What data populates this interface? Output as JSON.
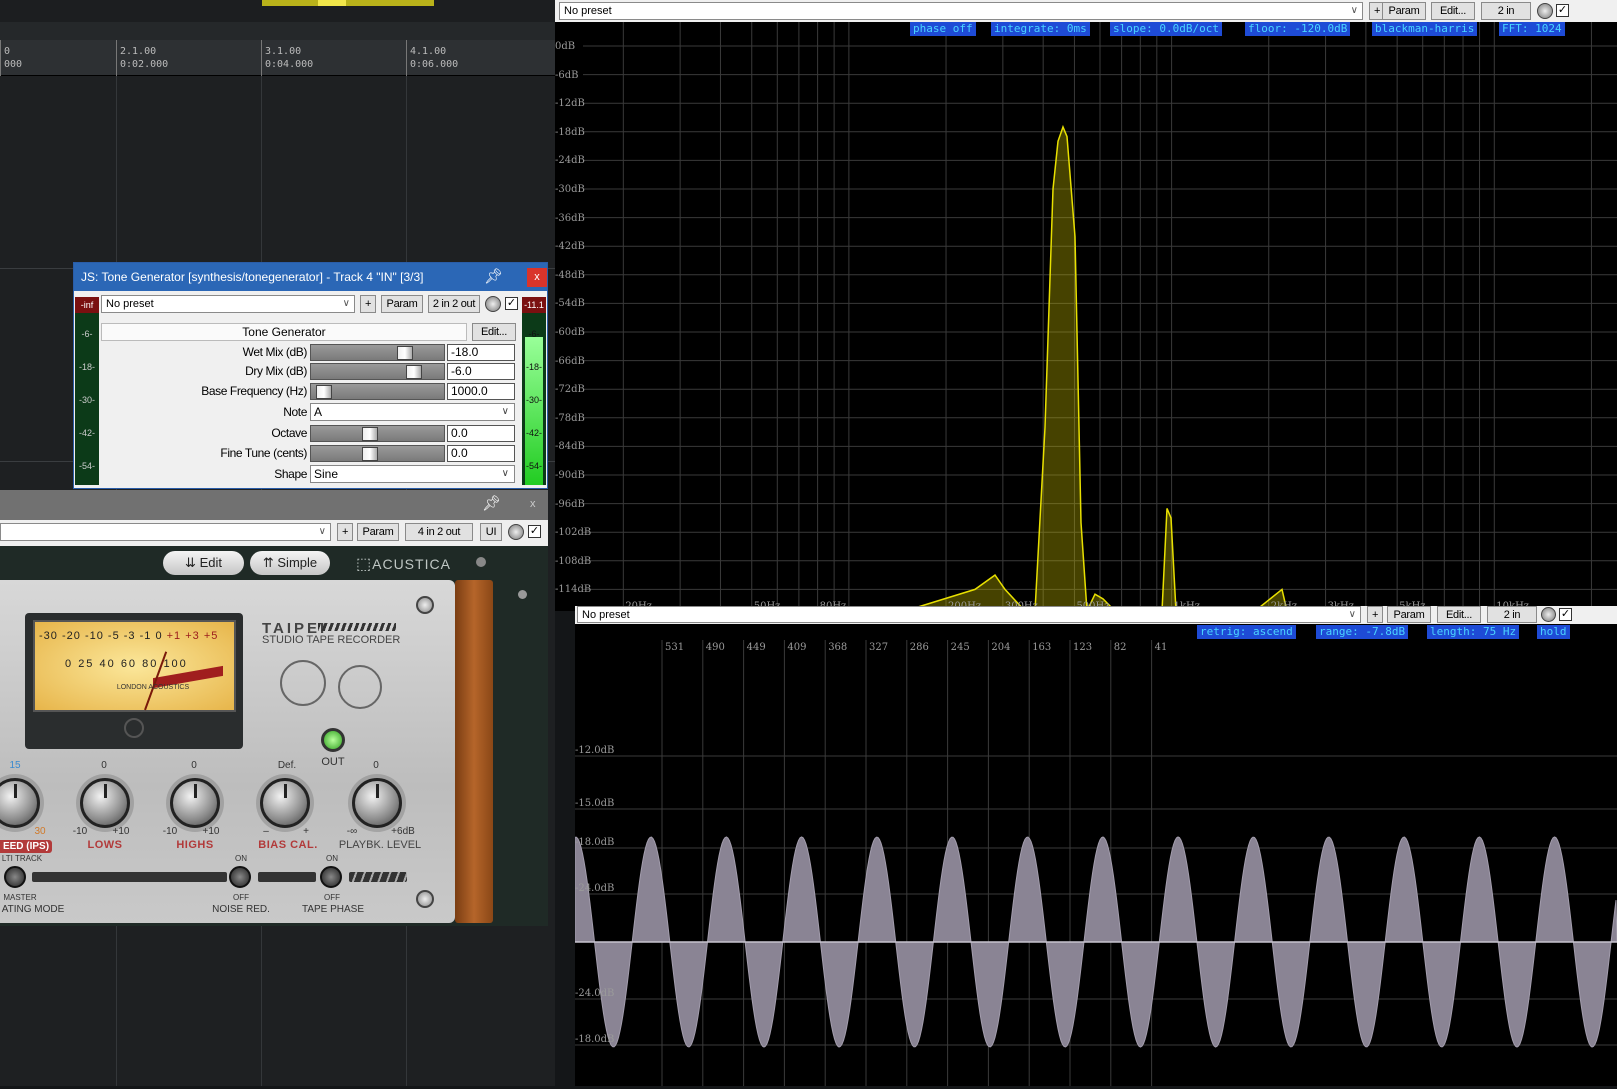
{
  "arrange": {
    "ruler": [
      {
        "bar": "0",
        "time": "000"
      },
      {
        "bar": "2.1.00",
        "time": "0:02.000"
      },
      {
        "bar": "3.1.00",
        "time": "0:04.000"
      },
      {
        "bar": "4.1.00",
        "time": "0:06.000"
      }
    ]
  },
  "tone_generator": {
    "title": "JS: Tone Generator [synthesis/tonegenerator] - Track 4 \"IN\" [3/3]",
    "close": "x",
    "preset": "No preset",
    "plus": "+",
    "param": "Param",
    "routing": "2 in 2 out",
    "name": "Tone Generator",
    "edit": "Edit...",
    "meter_in": {
      "top": "-inf",
      "ticks": [
        "-6-",
        "-18-",
        "-30-",
        "-42-",
        "-54-"
      ]
    },
    "meter_out": {
      "top": "-11.1",
      "ticks": [
        "-6-",
        "-18-",
        "-30-",
        "-42-",
        "-54-"
      ],
      "level": 0.86
    },
    "params": [
      {
        "label": "Wet Mix (dB)",
        "type": "slider",
        "value": "-18.0",
        "pos": 0.75
      },
      {
        "label": "Dry Mix (dB)",
        "type": "slider",
        "value": "-6.0",
        "pos": 0.83
      },
      {
        "label": "Base Frequency (Hz)",
        "type": "slider",
        "value": "1000.0",
        "pos": 0.04
      },
      {
        "label": "Note",
        "type": "select",
        "value": "A"
      },
      {
        "label": "Octave",
        "type": "slider",
        "value": "0.0",
        "pos": 0.44
      },
      {
        "label": "Fine Tune (cents)",
        "type": "slider",
        "value": "0.0",
        "pos": 0.44
      },
      {
        "label": "Shape",
        "type": "select",
        "value": "Sine"
      }
    ]
  },
  "taipei_window": {
    "close": "x",
    "plus": "+",
    "param": "Param",
    "routing": "4 in 2 out",
    "ui": "UI",
    "edit_btn": "Edit",
    "simple_btn": "Simple",
    "brand": "ACUSTICA",
    "model": "TAIPEI",
    "subtitle": "STUDIO TAPE RECORDER",
    "vu_scale": [
      "-30",
      "-20",
      "-10",
      "-5",
      "-3",
      "-1",
      "0",
      "+1",
      "+3",
      "+5"
    ],
    "vu_pct": [
      "0",
      "25",
      "40",
      "60",
      "80",
      "100"
    ],
    "vu_logo": "LONDON ACOUSTICS",
    "out_label": "OUT",
    "knobs": [
      {
        "top": "15",
        "bottom_right": "30",
        "label": "EED (IPS)"
      },
      {
        "top": "0",
        "bottom_left": "-10",
        "bottom_right": "+10",
        "label": "LOWS"
      },
      {
        "top": "0",
        "bottom_left": "-10",
        "bottom_right": "+10",
        "label": "HIGHS"
      },
      {
        "top": "Def.",
        "bottom_left": "–",
        "bottom_right": "+",
        "label": "BIAS CAL."
      },
      {
        "top": "0",
        "bottom_left": "-∞",
        "bottom_right": "+6dB",
        "label": "PLAYBK. LEVEL"
      }
    ],
    "multi_track": "LTI TRACK",
    "master": "MASTER",
    "operating_mode": "ATING MODE",
    "noise_on": "ON",
    "noise_off": "OFF",
    "noise_red": "NOISE RED.",
    "phase_on": "ON",
    "phase_off": "OFF",
    "tape_phase": "TAPE PHASE"
  },
  "analyzer": {
    "preset": "No preset",
    "plus": "+",
    "param": "Param",
    "edit": "Edit...",
    "routing": "2 in",
    "chips": [
      "phase off",
      "integrate: 0ms",
      "slope: 0.0dB/oct",
      "floor: -120.0dB",
      "blackman-harris",
      "FFT: 1024"
    ],
    "db_labels": [
      "0dB",
      "-6dB",
      "-12dB",
      "-18dB",
      "-24dB",
      "-30dB",
      "-36dB",
      "-42dB",
      "-48dB",
      "-54dB",
      "-60dB",
      "-66dB",
      "-72dB",
      "-78dB",
      "-84dB",
      "-90dB",
      "-96dB",
      "-102dB",
      "-108dB",
      "-114dB"
    ],
    "hz_labels": [
      "20Hz",
      "50Hz",
      "80Hz",
      "200Hz",
      "300Hz",
      "500Hz",
      "1kHz",
      "2kHz",
      "3kHz",
      "5kHz",
      "10kHz"
    ]
  },
  "oscilloscope": {
    "preset": "No preset",
    "plus": "+",
    "param": "Param",
    "edit": "Edit...",
    "routing": "2 in",
    "chips": [
      "retrig: ascend",
      "range: -7.8dB",
      "length: 75 Hz",
      "hold"
    ],
    "x_labels": [
      "531",
      "490",
      "449",
      "409",
      "368",
      "327",
      "286",
      "245",
      "204",
      "163",
      "123",
      "82",
      "41"
    ],
    "db_labels": [
      "-12.0dB",
      "-15.0dB",
      "-18.0dB",
      "-24.0dB",
      "-24.0dB",
      "-18.0dB"
    ]
  },
  "colors": {
    "spectrum": "#e8e000",
    "waveform": "#8a8494",
    "chip_bg": "#1e4bd6",
    "chip_text": "#4ad4ff"
  }
}
